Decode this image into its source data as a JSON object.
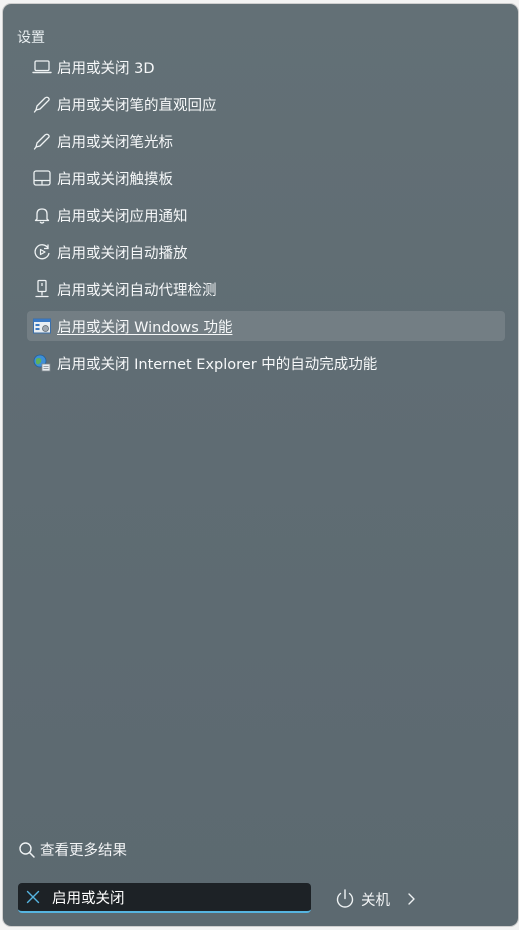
{
  "section_title": "设置",
  "results": [
    {
      "label": "启用或关闭 3D",
      "icon": "laptop-icon"
    },
    {
      "label": "启用或关闭笔的直观回应",
      "icon": "pen-icon"
    },
    {
      "label": "启用或关闭笔光标",
      "icon": "pen-icon"
    },
    {
      "label": "启用或关闭触摸板",
      "icon": "touchpad-icon"
    },
    {
      "label": "启用或关闭应用通知",
      "icon": "bell-icon"
    },
    {
      "label": "启用或关闭自动播放",
      "icon": "autoplay-icon"
    },
    {
      "label": "启用或关闭自动代理检测",
      "icon": "proxy-icon"
    },
    {
      "label": "启用或关闭 Windows 功能",
      "icon": "windows-features-icon",
      "selected": true
    },
    {
      "label": "启用或关闭 Internet Explorer 中的自动完成功能",
      "icon": "internet-options-icon"
    }
  ],
  "more_results": "查看更多结果",
  "search": {
    "value": "启用或关闭"
  },
  "power": {
    "label": "关机"
  },
  "colors": {
    "accent": "#56b4e0",
    "panel": "#607078",
    "selected_bg": "rgba(255,255,255,0.12)"
  }
}
